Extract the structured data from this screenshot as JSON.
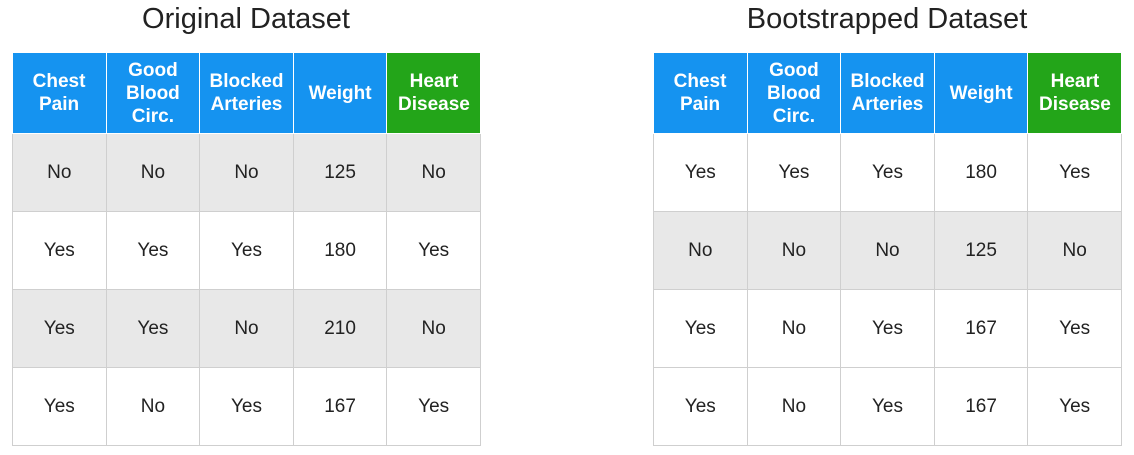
{
  "original": {
    "title": "Original Dataset",
    "headers": [
      "Chest\nPain",
      "Good\nBlood\nCirc.",
      "Blocked\nArteries",
      "Weight",
      "Heart\nDisease"
    ],
    "rows": [
      [
        "No",
        "No",
        "No",
        "125",
        "No"
      ],
      [
        "Yes",
        "Yes",
        "Yes",
        "180",
        "Yes"
      ],
      [
        "Yes",
        "Yes",
        "No",
        "210",
        "No"
      ],
      [
        "Yes",
        "No",
        "Yes",
        "167",
        "Yes"
      ]
    ]
  },
  "bootstrapped": {
    "title": "Bootstrapped Dataset",
    "headers": [
      "Chest\nPain",
      "Good\nBlood\nCirc.",
      "Blocked\nArteries",
      "Weight",
      "Heart\nDisease"
    ],
    "rows": [
      [
        "Yes",
        "Yes",
        "Yes",
        "180",
        "Yes"
      ],
      [
        "No",
        "No",
        "No",
        "125",
        "No"
      ],
      [
        "Yes",
        "No",
        "Yes",
        "167",
        "Yes"
      ],
      [
        "Yes",
        "No",
        "Yes",
        "167",
        "Yes"
      ]
    ]
  },
  "colors": {
    "feature_header": "#1593f0",
    "target_header": "#23a519",
    "shaded_row": "#e8e8e8",
    "grid_line": "#cfcfcf"
  }
}
